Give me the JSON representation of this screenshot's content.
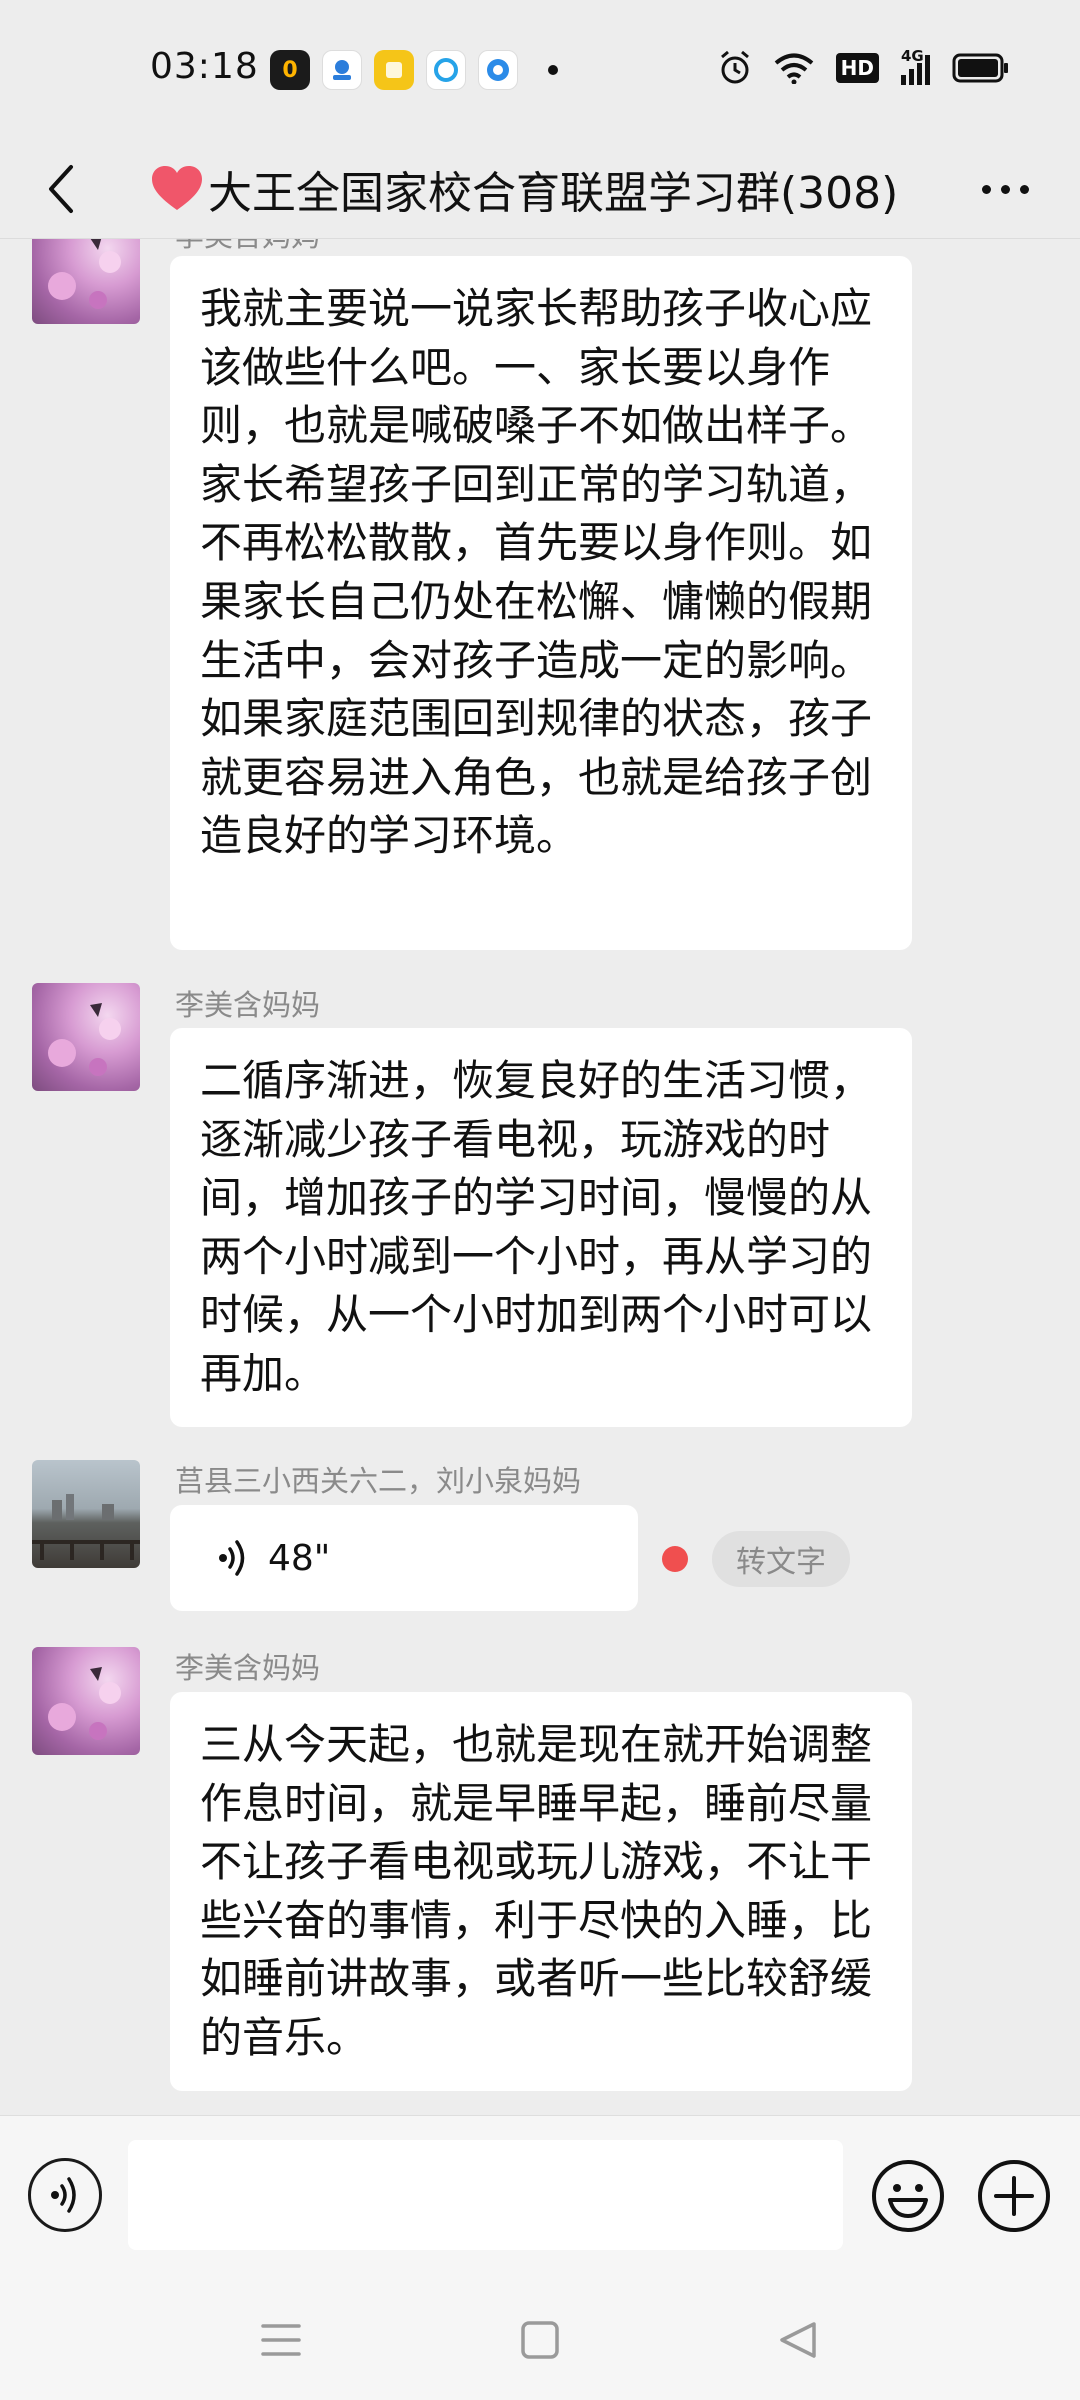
{
  "status_bar": {
    "time": "03:18",
    "network_label": "4G",
    "hd_label": "HD"
  },
  "header": {
    "title": "大王全国家校合育联盟学习群(308)",
    "heart_color": "#f0566a"
  },
  "messages": [
    {
      "type": "text",
      "sender": "李美含妈妈",
      "text": "我就主要说一说家长帮助孩子收心应该做些什么吧。一、家长要以身作则，也就是喊破嗓子不如做出样子。家长希望孩子回到正常的学习轨道，不再松松散散，首先要以身作则。如果家长自己仍处在松懈、慵懒的假期生活中，会对孩子造成一定的影响。如果家庭范围回到规律的状态，孩子就更容易进入角色，也就是给孩子创造良好的学习环境。"
    },
    {
      "type": "text",
      "sender": "李美含妈妈",
      "text": "二循序渐进，恢复良好的生活习惯，逐渐减少孩子看电视，玩游戏的时间，增加孩子的学习时间，慢慢的从两个小时减到一个小时，再从学习的时候，从一个小时加到两个小时可以再加。"
    },
    {
      "type": "voice",
      "sender": "莒县三小西关六二，刘小泉妈妈",
      "duration": "48\"",
      "convert_label": "转文字"
    },
    {
      "type": "text",
      "sender": "李美含妈妈",
      "text": "三从今天起，也就是现在就开始调整作息时间，就是早睡早起，睡前尽量不让孩子看电视或玩儿游戏，不让干些兴奋的事情，利于尽快的入睡，比如睡前讲故事，或者听一些比较舒缓的音乐。"
    }
  ],
  "input_bar": {
    "placeholder": ""
  },
  "icons": [
    "back-icon",
    "more-icon",
    "voice-icon",
    "emoji-icon",
    "plus-icon",
    "menu-nav-icon",
    "home-nav-icon",
    "back-nav-icon"
  ]
}
